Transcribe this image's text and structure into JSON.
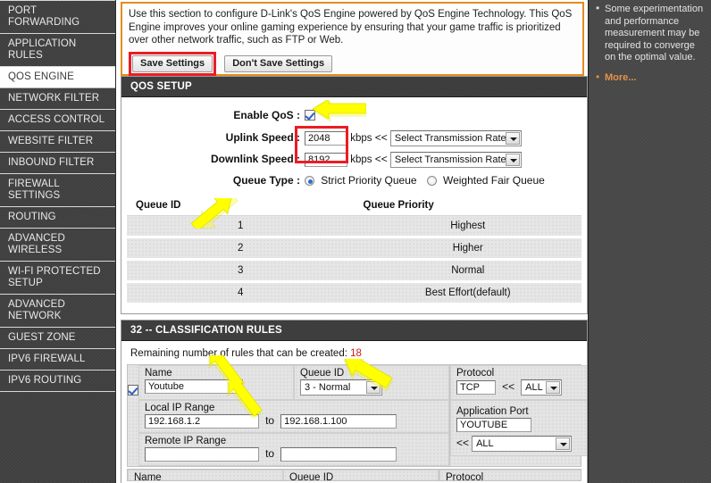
{
  "sidebar": {
    "items": [
      {
        "label": "PORT FORWARDING",
        "active": false
      },
      {
        "label": "APPLICATION RULES",
        "active": false
      },
      {
        "label": "QOS ENGINE",
        "active": true
      },
      {
        "label": "NETWORK FILTER",
        "active": false
      },
      {
        "label": "ACCESS CONTROL",
        "active": false
      },
      {
        "label": "WEBSITE FILTER",
        "active": false
      },
      {
        "label": "INBOUND FILTER",
        "active": false
      },
      {
        "label": "FIREWALL SETTINGS",
        "active": false
      },
      {
        "label": "ROUTING",
        "active": false
      },
      {
        "label": "ADVANCED WIRELESS",
        "active": false
      },
      {
        "label": "WI-FI PROTECTED SETUP",
        "active": false
      },
      {
        "label": "ADVANCED NETWORK",
        "active": false
      },
      {
        "label": "GUEST ZONE",
        "active": false
      },
      {
        "label": "IPV6 FIREWALL",
        "active": false
      },
      {
        "label": "IPV6 ROUTING",
        "active": false
      }
    ]
  },
  "info": {
    "description": "Use this section to configure D-Link's QoS Engine powered by QoS Engine Technology. This QoS Engine improves your online gaming experience by ensuring that your game traffic is prioritized over other network traffic, such as FTP or Web.",
    "save_label": "Save Settings",
    "dont_save_label": "Don't Save Settings"
  },
  "qos_setup": {
    "title": "QOS SETUP",
    "enable_label": "Enable QoS :",
    "enable_checked": true,
    "uplink_label": "Uplink Speed :",
    "uplink_value": "2048",
    "uplink_unit": "kbps",
    "uplink_arrows": "<<",
    "uplink_select": "Select Transmission Rate",
    "downlink_label": "Downlink Speed :",
    "downlink_value": "8192",
    "downlink_unit": "kbps",
    "downlink_arrows": "<<",
    "downlink_select": "Select Transmission Rate",
    "queue_type_label": "Queue Type :",
    "queue_type_option1": "Strict Priority Queue",
    "queue_type_option2": "Weighted Fair Queue",
    "queue_type_selected": "Strict Priority Queue"
  },
  "queue_table": {
    "headers": [
      "Queue ID",
      "Queue Priority"
    ],
    "rows": [
      {
        "id": "1",
        "priority": "Highest"
      },
      {
        "id": "2",
        "priority": "Higher"
      },
      {
        "id": "3",
        "priority": "Normal"
      },
      {
        "id": "4",
        "priority": "Best Effort(default)"
      }
    ]
  },
  "classification": {
    "title": "32 -- CLASSIFICATION RULES",
    "remaining_text": "Remaining number of rules that can be created:",
    "remaining_count": "18",
    "rule": {
      "enabled": true,
      "name_label": "Name",
      "name_value": "Youtube",
      "queue_id_label": "Queue ID",
      "queue_id_value": "3 - Normal",
      "protocol_label": "Protocol",
      "protocol_value": "TCP",
      "protocol_arrows": "<<",
      "protocol_select": "ALL",
      "local_ip_label": "Local IP Range",
      "local_ip_start": "192.168.1.2",
      "local_ip_to": "to",
      "local_ip_end": "192.168.1.100",
      "remote_ip_label": "Remote IP Range",
      "remote_ip_start": "",
      "remote_ip_to": "to",
      "remote_ip_end": "",
      "app_port_label": "Application Port",
      "app_port_value": "YOUTUBE",
      "app_port_arrows": "<<",
      "app_port_select": "ALL"
    },
    "next_rule_partial": {
      "name_label": "Name",
      "queue_id_label": "Queue ID",
      "protocol_label": "Protocol"
    }
  },
  "help": {
    "bullets": [
      "Some experimentation and performance measurement may be required to converge on the optimal value."
    ],
    "more_label": "More..."
  },
  "colors": {
    "accent_orange": "#e58c1e",
    "highlight_red": "#ec1c24",
    "arrow_yellow": "#ffff00",
    "sidebar_dark": "#3e3e3e",
    "link_orange": "#e59248",
    "count_red": "#d21a1a"
  }
}
